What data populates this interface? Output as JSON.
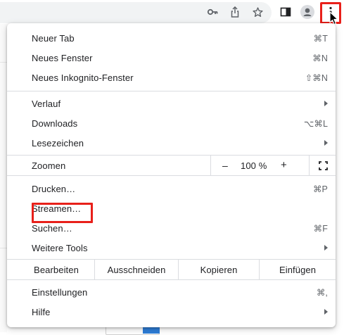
{
  "menu": {
    "items_group1": [
      {
        "label": "Neuer Tab",
        "shortcut": "⌘T"
      },
      {
        "label": "Neues Fenster",
        "shortcut": "⌘N"
      },
      {
        "label": "Neues Inkognito-Fenster",
        "shortcut": "⇧⌘N"
      }
    ],
    "items_group2": [
      {
        "label": "Verlauf"
      },
      {
        "label": "Downloads",
        "shortcut": "⌥⌘L"
      },
      {
        "label": "Lesezeichen"
      }
    ],
    "zoom": {
      "label": "Zoomen",
      "minus": "–",
      "value": "100 %",
      "plus": "+"
    },
    "items_group3": [
      {
        "label": "Drucken…",
        "shortcut": "⌘P"
      },
      {
        "label": "Streamen…"
      },
      {
        "label": "Suchen…",
        "shortcut": "⌘F"
      },
      {
        "label": "Weitere Tools"
      }
    ],
    "edit": {
      "label": "Bearbeiten",
      "cut": "Ausschneiden",
      "copy": "Kopieren",
      "paste": "Einfügen"
    },
    "items_group4": [
      {
        "label": "Einstellungen",
        "shortcut": "⌘,"
      },
      {
        "label": "Hilfe"
      }
    ]
  },
  "colors": {
    "highlight": "#e8201a",
    "text": "#202124",
    "secondary": "#5f6368"
  },
  "icons": [
    "key-icon",
    "share-icon",
    "star-icon",
    "side-panel-icon",
    "profile-icon",
    "kebab-menu-icon",
    "fullscreen-icon",
    "submenu-arrow-icon"
  ]
}
